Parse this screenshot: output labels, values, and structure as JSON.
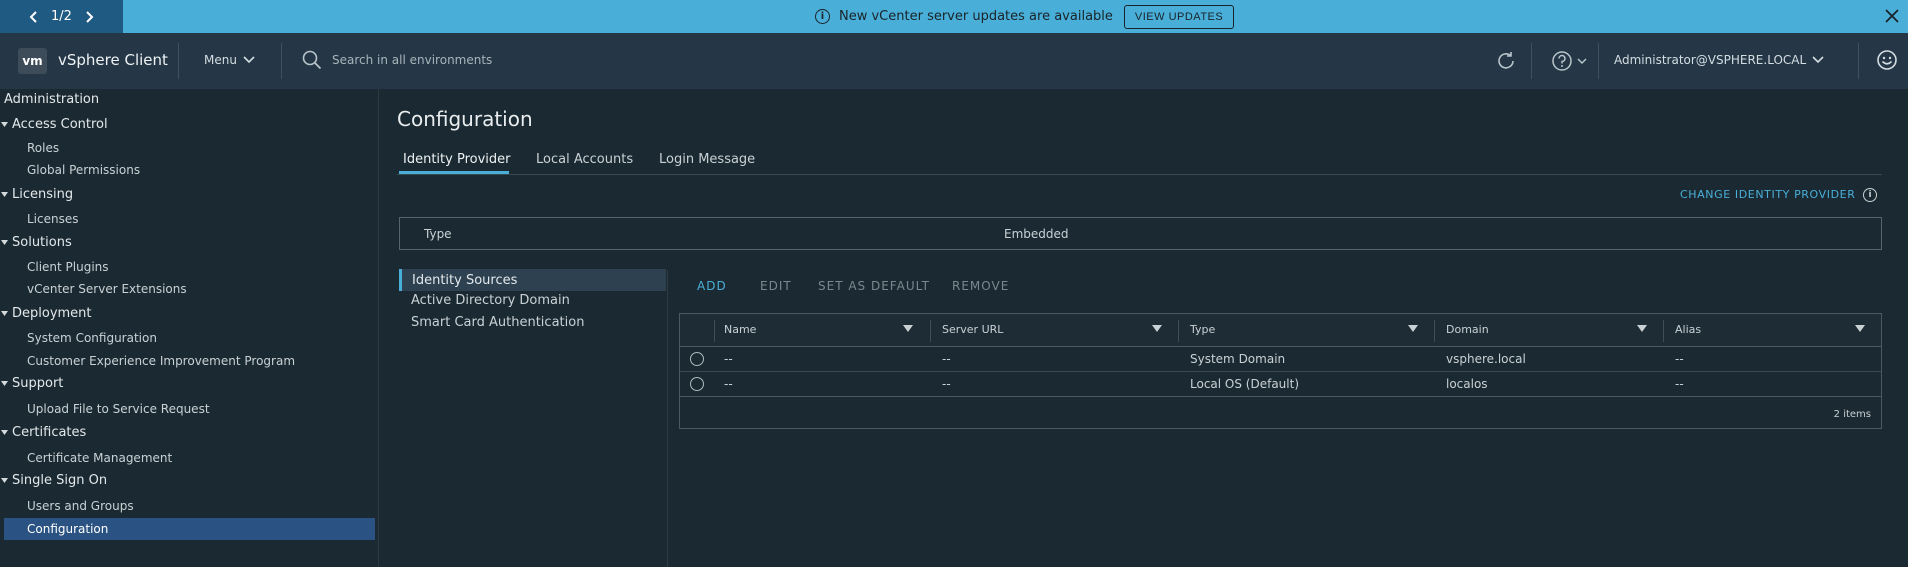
{
  "banner": {
    "pager": "1/2",
    "message": "New vCenter server updates are available",
    "action_label": "VIEW UPDATES"
  },
  "header": {
    "logo_text": "vm",
    "app_title": "vSphere Client",
    "menu_label": "Menu",
    "search_placeholder": "Search in all environments",
    "user_label": "Administrator@VSPHERE.LOCAL"
  },
  "sidebar": {
    "title": "Administration",
    "groups": [
      {
        "label": "Access Control",
        "items": [
          "Roles",
          "Global Permissions"
        ]
      },
      {
        "label": "Licensing",
        "items": [
          "Licenses"
        ]
      },
      {
        "label": "Solutions",
        "items": [
          "Client Plugins",
          "vCenter Server Extensions"
        ]
      },
      {
        "label": "Deployment",
        "items": [
          "System Configuration",
          "Customer Experience Improvement Program"
        ]
      },
      {
        "label": "Support",
        "items": [
          "Upload File to Service Request"
        ]
      },
      {
        "label": "Certificates",
        "items": [
          "Certificate Management"
        ]
      },
      {
        "label": "Single Sign On",
        "items": [
          "Users and Groups",
          "Configuration"
        ]
      }
    ],
    "active_item": "Configuration"
  },
  "main": {
    "title": "Configuration",
    "tabs": [
      {
        "label": "Identity Provider",
        "active": true
      },
      {
        "label": "Local Accounts",
        "active": false
      },
      {
        "label": "Login Message",
        "active": false
      }
    ],
    "change_identity_provider": "CHANGE IDENTITY PROVIDER",
    "type_label": "Type",
    "type_value": "Embedded",
    "sources_nav": [
      "Identity Sources",
      "Active Directory Domain",
      "Smart Card Authentication"
    ],
    "actions": {
      "add": "ADD",
      "edit": "EDIT",
      "set_default": "SET AS DEFAULT",
      "remove": "REMOVE"
    },
    "grid": {
      "columns": [
        "Name",
        "Server URL",
        "Type",
        "Domain",
        "Alias"
      ],
      "rows": [
        [
          "--",
          "--",
          "System Domain",
          "vsphere.local",
          "--"
        ],
        [
          "--",
          "--",
          "Local OS (Default)",
          "localos",
          "--"
        ]
      ],
      "count": "2 items"
    }
  },
  "colors": {
    "accent": "#49afd9",
    "banner_bg": "#49afd9",
    "header_bg": "#253746",
    "active_nav": "#2a5282",
    "background": "#1b2a32"
  }
}
